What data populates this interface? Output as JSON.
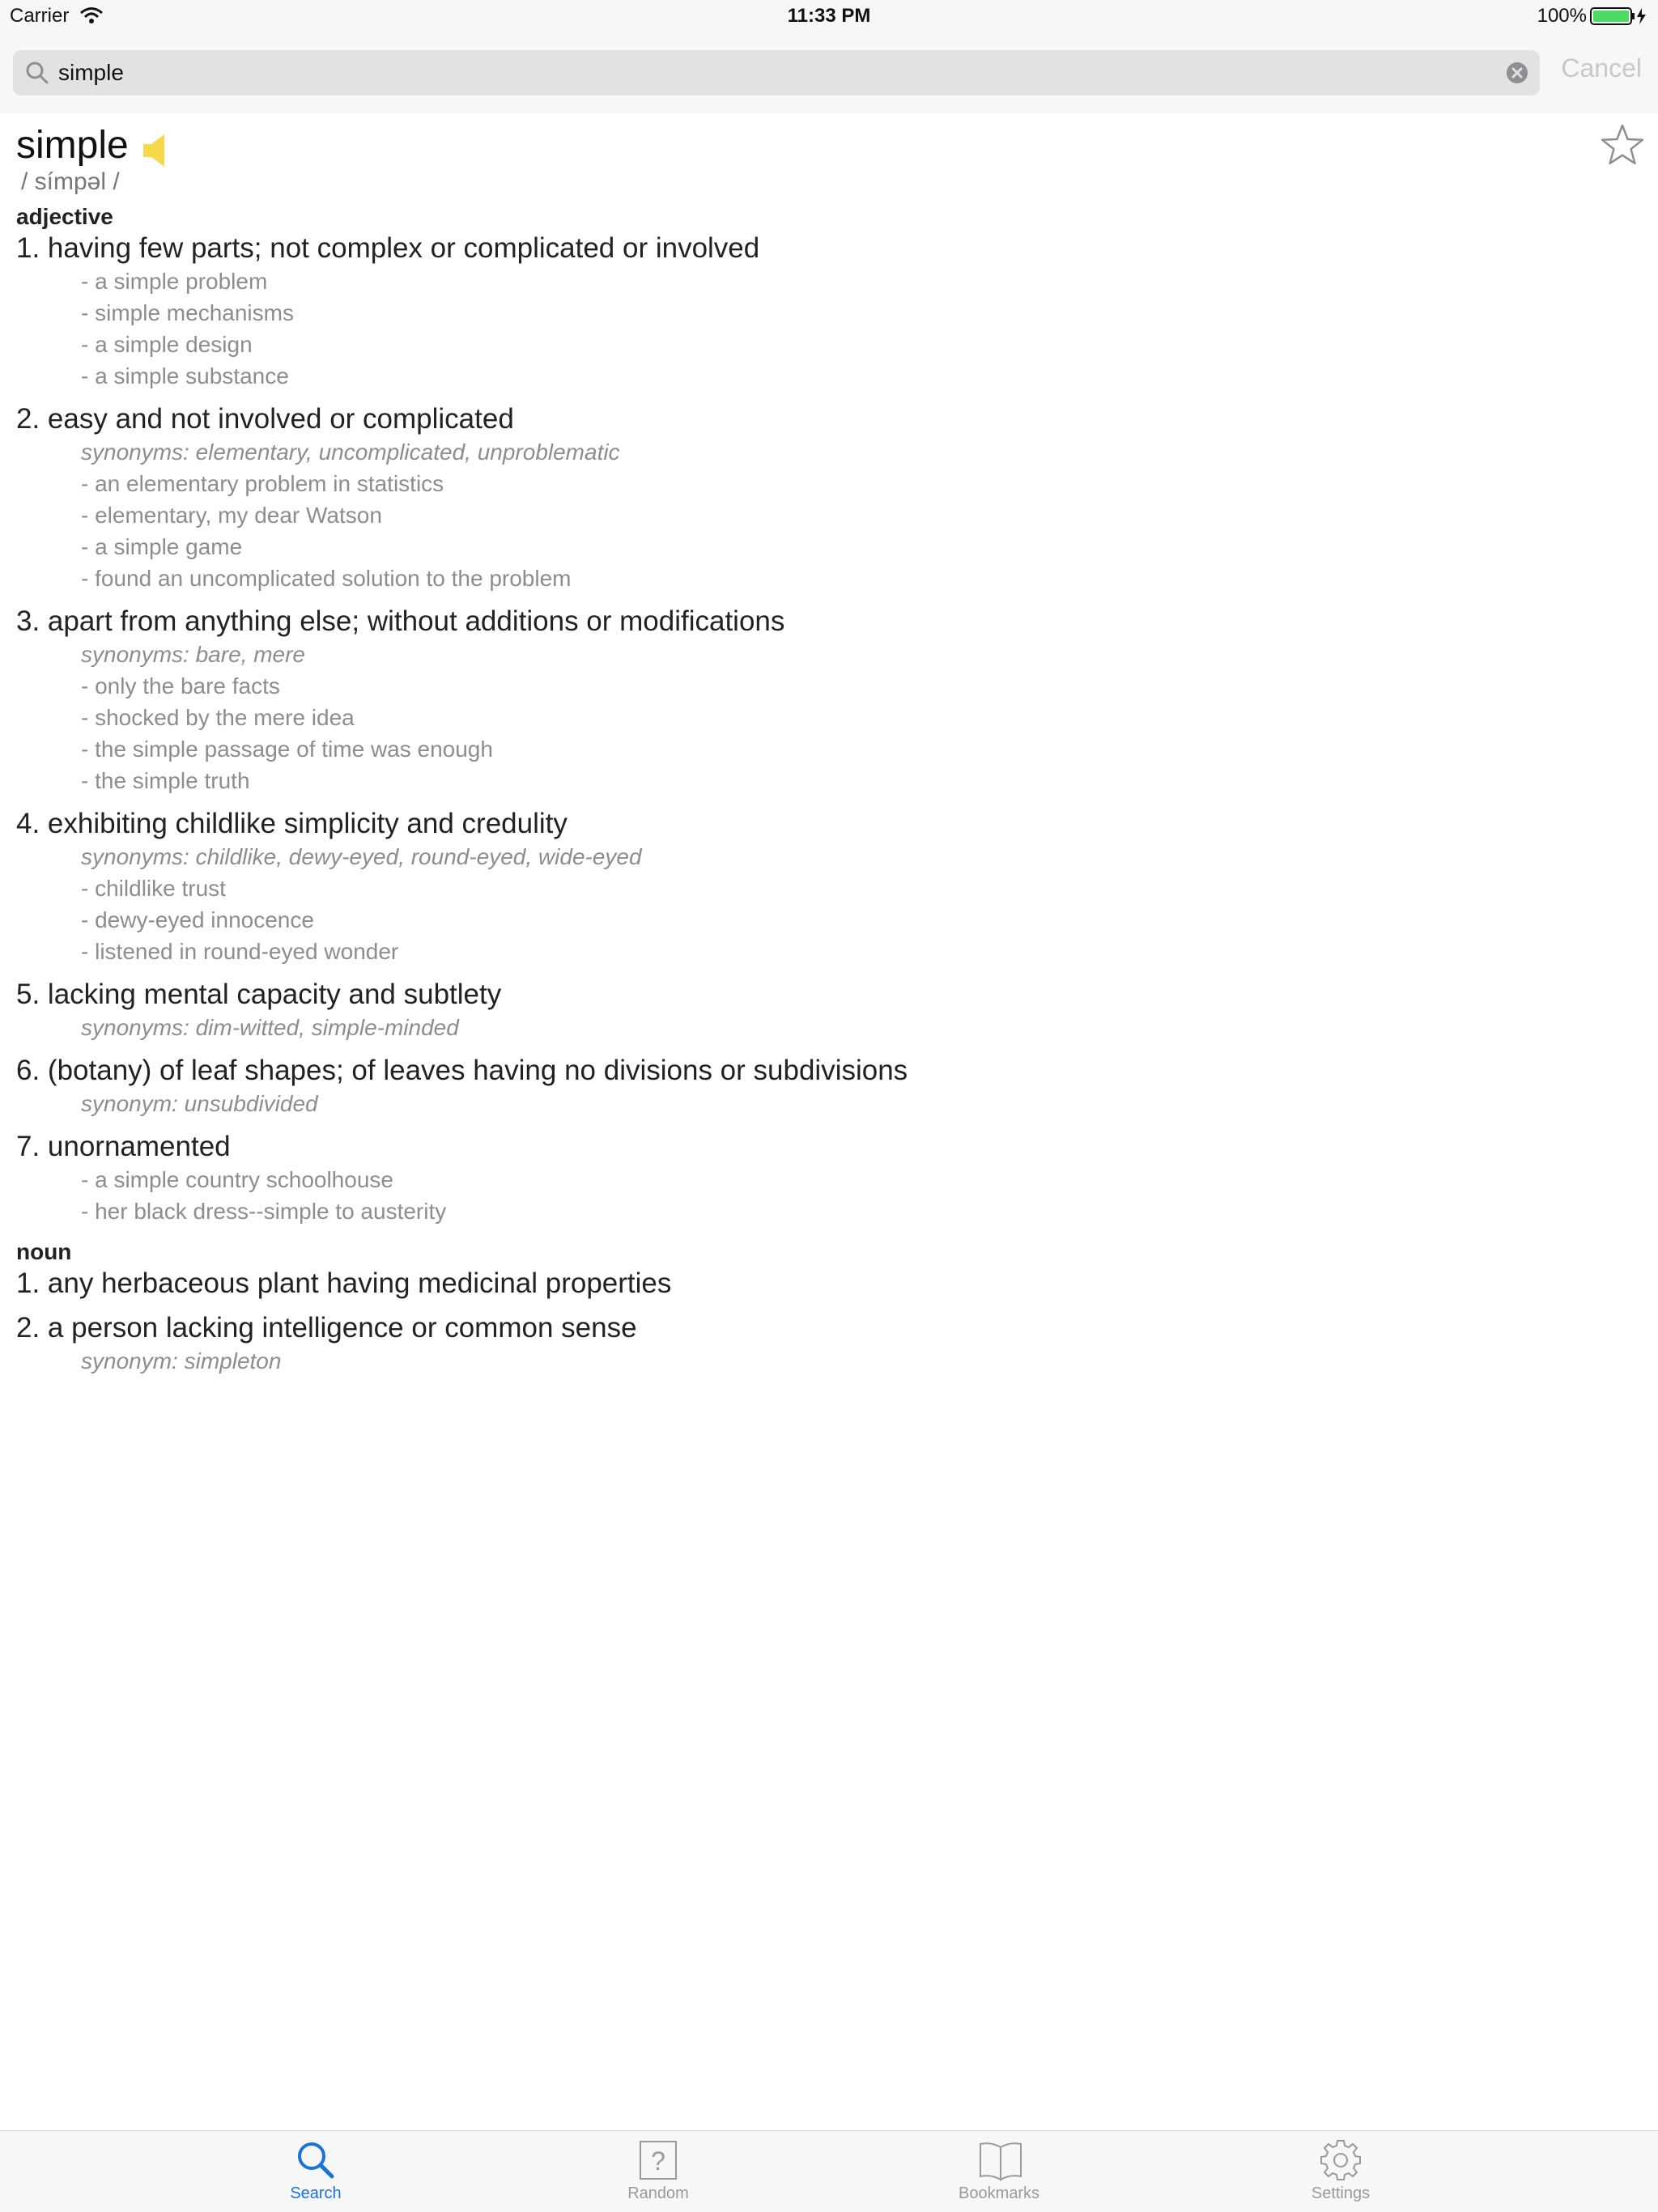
{
  "status_bar": {
    "carrier": "Carrier",
    "time": "11:33 PM",
    "battery": "100%",
    "battery_color": "#4cd964"
  },
  "search": {
    "query": "simple",
    "cancel_label": "Cancel"
  },
  "entry": {
    "word": "simple",
    "phonetic": "/ símpəl /",
    "speaker_color": "#f5d94a",
    "sections": [
      {
        "pos": "adjective",
        "senses": [
          {
            "text": "1. having few parts; not complex or complicated or involved",
            "synonyms": "",
            "examples": [
              "- a simple problem",
              "- simple mechanisms",
              "- a simple design",
              "- a simple substance"
            ]
          },
          {
            "text": "2. easy and not involved or complicated",
            "synonyms": "synonyms: elementary, uncomplicated, unproblematic",
            "examples": [
              "- an elementary problem in statistics",
              "- elementary, my dear Watson",
              "- a simple game",
              "- found an uncomplicated solution to the problem"
            ]
          },
          {
            "text": "3. apart from anything else; without additions or modifications",
            "synonyms": "synonyms: bare, mere",
            "examples": [
              "- only the bare facts",
              "- shocked by the mere idea",
              "- the simple passage of time was enough",
              "- the simple truth"
            ]
          },
          {
            "text": "4. exhibiting childlike simplicity and credulity",
            "synonyms": "synonyms: childlike, dewy-eyed, round-eyed, wide-eyed",
            "examples": [
              "- childlike trust",
              "- dewy-eyed innocence",
              "- listened in round-eyed wonder"
            ]
          },
          {
            "text": "5. lacking mental capacity and subtlety",
            "synonyms": "synonyms: dim-witted, simple-minded",
            "examples": []
          },
          {
            "text": "6. (botany) of leaf shapes; of leaves having no divisions or subdivisions",
            "synonyms": "synonym: unsubdivided",
            "examples": []
          },
          {
            "text": "7. unornamented",
            "synonyms": "",
            "examples": [
              "- a simple country schoolhouse",
              "- her black dress--simple to austerity"
            ]
          }
        ]
      },
      {
        "pos": "noun",
        "senses": [
          {
            "text": "1. any herbaceous plant having medicinal properties",
            "synonyms": "",
            "examples": []
          },
          {
            "text": "2. a person lacking intelligence or common sense",
            "synonyms": "synonym: simpleton",
            "examples": []
          }
        ]
      }
    ]
  },
  "tabs": [
    {
      "label": "Search",
      "icon": "search-icon",
      "active": true
    },
    {
      "label": "Random",
      "icon": "question-icon",
      "active": false
    },
    {
      "label": "Bookmarks",
      "icon": "book-icon",
      "active": false
    },
    {
      "label": "Settings",
      "icon": "gear-icon",
      "active": false
    }
  ],
  "colors": {
    "accent": "#1a73d9",
    "inactive": "#9a9a9a"
  }
}
